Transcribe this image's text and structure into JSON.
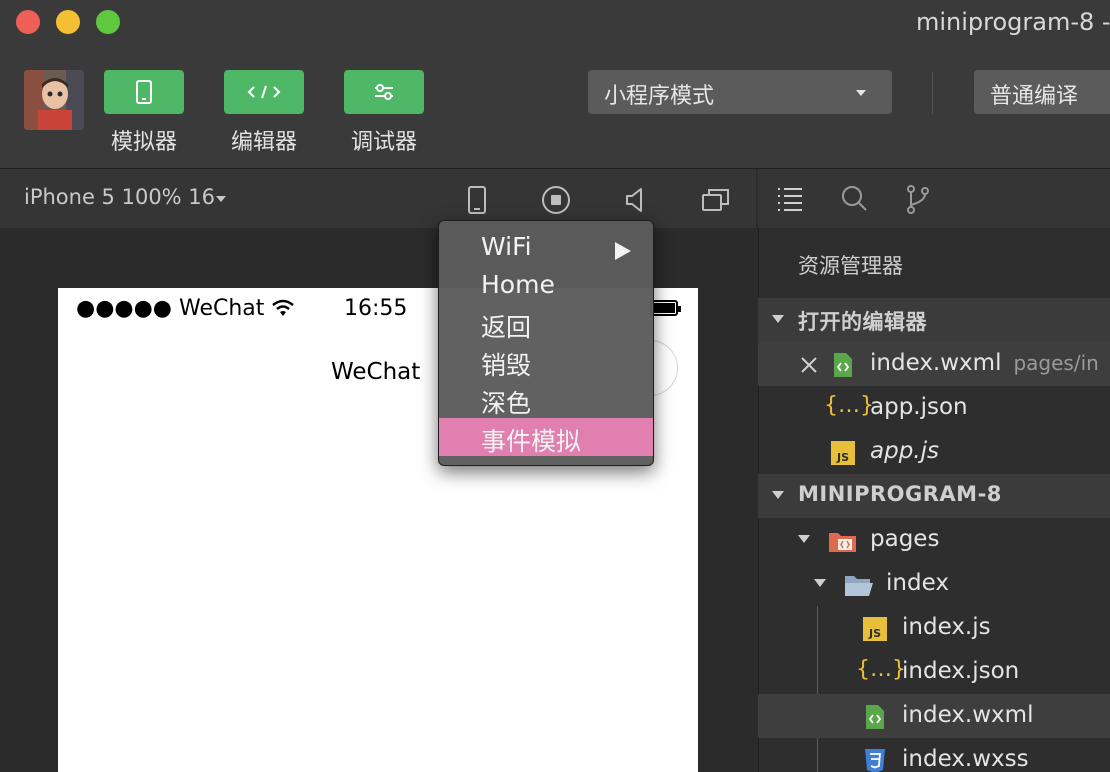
{
  "window": {
    "title": "miniprogram-8 -",
    "traffic_colors": [
      "#ee5f58",
      "#f5bf33",
      "#5fc83f"
    ]
  },
  "toolbar": {
    "buttons": [
      {
        "label": "模拟器",
        "icon": "phone-icon"
      },
      {
        "label": "编辑器",
        "icon": "code-icon"
      },
      {
        "label": "调试器",
        "icon": "sliders-icon"
      }
    ],
    "mode_select": "小程序模式",
    "compile_select": "普通编译",
    "accent": "#4fb867"
  },
  "simulator": {
    "device": "iPhone 5 100% 16",
    "icons": [
      "phone-icon",
      "record-icon",
      "volume-icon",
      "windows-icon"
    ],
    "status_bar": {
      "carrier": "●●●●● WeChat",
      "time": "16:55"
    },
    "nav_title": "WeChat"
  },
  "context_menu": {
    "items": [
      {
        "label": "WiFi",
        "submenu": true
      },
      {
        "label": "Home"
      },
      {
        "label": "返回"
      },
      {
        "label": "销毁"
      },
      {
        "label": "深色"
      },
      {
        "label": "事件模拟",
        "highlighted": true
      }
    ],
    "highlight_color": "#e07fb0"
  },
  "explorer": {
    "tabs": [
      "list-icon",
      "search-icon",
      "git-branch-icon"
    ],
    "title": "资源管理器",
    "open_editors": {
      "header": "打开的编辑器",
      "files": [
        {
          "name": "index.wxml",
          "path": "pages/in",
          "icon": "wxml-icon",
          "has_close": true
        },
        {
          "name": "app.json",
          "icon": "json-icon"
        },
        {
          "name": "app.js",
          "icon": "js-icon",
          "italic": true
        }
      ]
    },
    "project": {
      "header": "MINIPROGRAM-8",
      "tree": [
        {
          "name": "pages",
          "icon": "folder-icon"
        },
        {
          "name": "index",
          "icon": "folder-open-icon"
        },
        {
          "name": "index.js",
          "icon": "js-icon"
        },
        {
          "name": "index.json",
          "icon": "json-icon"
        },
        {
          "name": "index.wxml",
          "icon": "wxml-icon",
          "selected": true
        },
        {
          "name": "index.wxss",
          "icon": "css-icon"
        }
      ]
    }
  }
}
